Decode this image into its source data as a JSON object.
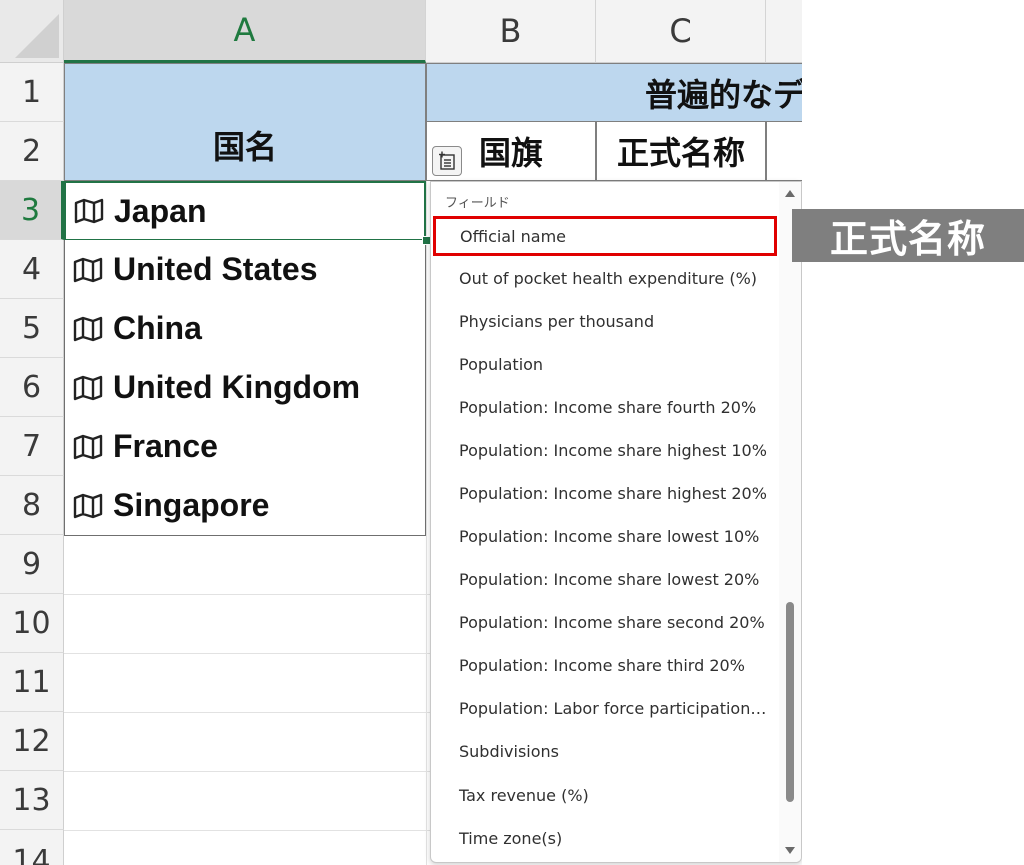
{
  "columns": [
    "A",
    "B",
    "C"
  ],
  "rows": [
    "1",
    "2",
    "3",
    "4",
    "5",
    "6",
    "7",
    "8",
    "9",
    "10",
    "11",
    "12",
    "13",
    "14"
  ],
  "header": {
    "country_name": "国名",
    "merged_title": "普遍的なデ",
    "flag": "国旗",
    "official_name": "正式名称",
    "cut": "・"
  },
  "countries": [
    "Japan",
    "United States",
    "China",
    "United Kingdom",
    "France",
    "Singapore"
  ],
  "dropdown": {
    "heading": "フィールド",
    "items": [
      "Official name",
      "Out of pocket health expenditure (%)",
      "Physicians per thousand",
      "Population",
      "Population: Income share fourth 20%",
      "Population: Income share highest 10%",
      "Population: Income share highest 20%",
      "Population: Income share lowest 10%",
      "Population: Income share lowest 20%",
      "Population: Income share second 20%",
      "Population: Income share third 20%",
      "Population: Labor force participation…",
      "Subdivisions",
      "Tax revenue (%)",
      "Time zone(s)"
    ]
  },
  "callout": "正式名称",
  "icons": {
    "row_icon": "map-icon",
    "insert_button": "insert-data-icon"
  },
  "colors": {
    "header_fill": "#bdd7ee",
    "selection": "#217346",
    "highlight": "#e00000",
    "callout_bg": "#7f7f7f"
  }
}
